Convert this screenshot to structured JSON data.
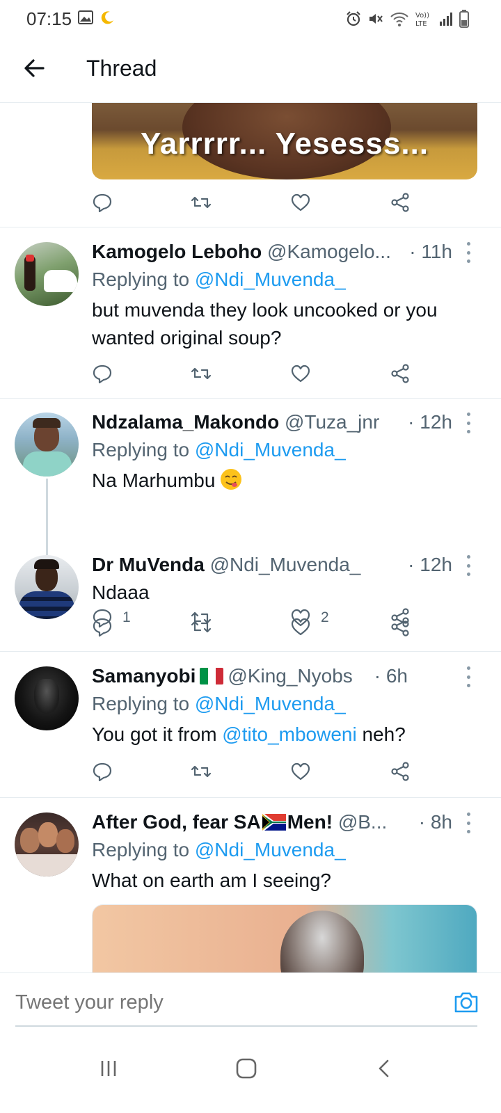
{
  "status_bar": {
    "time": "07:15",
    "left_icons": [
      "gallery-icon",
      "moon-icon"
    ],
    "right_icons": [
      "alarm-icon",
      "mute-icon",
      "wifi-icon",
      "volte-icon",
      "signal-icon",
      "battery-icon"
    ],
    "volte_label_top": "Vo))",
    "volte_label_bottom": "LTE"
  },
  "header": {
    "title": "Thread"
  },
  "top_media": {
    "caption": "Yarrrrr... Yesesss..."
  },
  "top_actions": {
    "reply_count": "",
    "like_count": ""
  },
  "tweets": [
    {
      "name": "Kamogelo Leboho",
      "handle": "@Kamogelo...",
      "time": "· 11h",
      "replying_label": "Replying to",
      "replying_to": "@Ndi_Muvenda_",
      "text": "but muvenda they look uncooked or you wanted original soup?",
      "reply_count": "",
      "like_count": ""
    },
    {
      "name": "Ndzalama_Makondo",
      "handle": "@Tuza_jnr",
      "time": "· 12h",
      "replying_label": "Replying to",
      "replying_to": "@Ndi_Muvenda_",
      "text": "Na Marhumbu",
      "reply_count": "1",
      "like_count": "2"
    },
    {
      "name": "Dr MuVenda",
      "handle": "@Ndi_Muvenda_",
      "time": "· 12h",
      "text": "Ndaaa",
      "reply_count": "",
      "like_count": ""
    },
    {
      "name": "Samanyobi",
      "handle": "@King_Nyobs",
      "time": "· 6h",
      "replying_label": "Replying to",
      "replying_to": "@Ndi_Muvenda_",
      "text_before": "You got it from",
      "text_mention": "@tito_mboweni",
      "text_after": "neh?",
      "reply_count": "",
      "like_count": ""
    },
    {
      "name_before_flag": "After God, fear SA",
      "name_after_flag": "Men!",
      "handle": "@B...",
      "time": "· 8h",
      "replying_label": "Replying to",
      "replying_to": "@Ndi_Muvenda_",
      "text": "What on earth am I seeing?"
    }
  ],
  "composer": {
    "placeholder": "Tweet your reply"
  },
  "colors": {
    "link": "#1d9bf0",
    "secondary_text": "#536471",
    "divider": "#e6ecf0"
  }
}
